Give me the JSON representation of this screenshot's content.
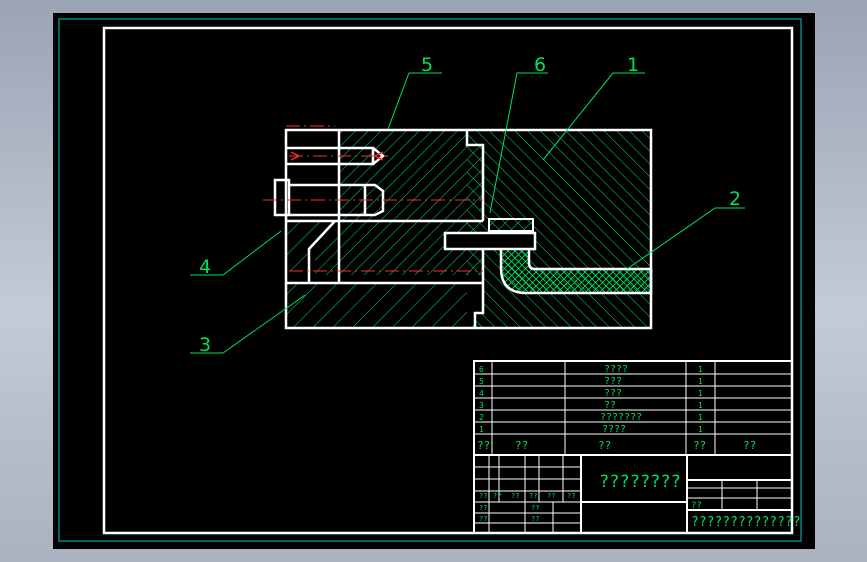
{
  "labels": {
    "part1": "1",
    "part2": "2",
    "part3": "3",
    "part4": "4",
    "part5": "5",
    "part6": "6"
  },
  "bom": {
    "rows": [
      {
        "no": "6",
        "name": "????",
        "qty": "1"
      },
      {
        "no": "5",
        "name": "???",
        "qty": "1"
      },
      {
        "no": "4",
        "name": "???",
        "qty": "1"
      },
      {
        "no": "3",
        "name": "??",
        "qty": "1"
      },
      {
        "no": "2",
        "name": "???????",
        "qty": "1"
      },
      {
        "no": "1",
        "name": "????",
        "qty": "1"
      }
    ],
    "header": {
      "c1": "??",
      "c2": "??",
      "c3": "??",
      "c4": "??",
      "c5": "??"
    }
  },
  "title_block": {
    "drawing_title": "????????",
    "scale_label": "??",
    "company": "??????????????",
    "small_marks": [
      "??",
      "??",
      "??",
      "??",
      "??",
      "??",
      "??",
      "??",
      "??",
      "??"
    ]
  },
  "colors": {
    "background": "#000000",
    "outline": "#ffffff",
    "hatch": "#00e060",
    "centerline": "#ff2a2a",
    "frame": "#00c8c8"
  }
}
